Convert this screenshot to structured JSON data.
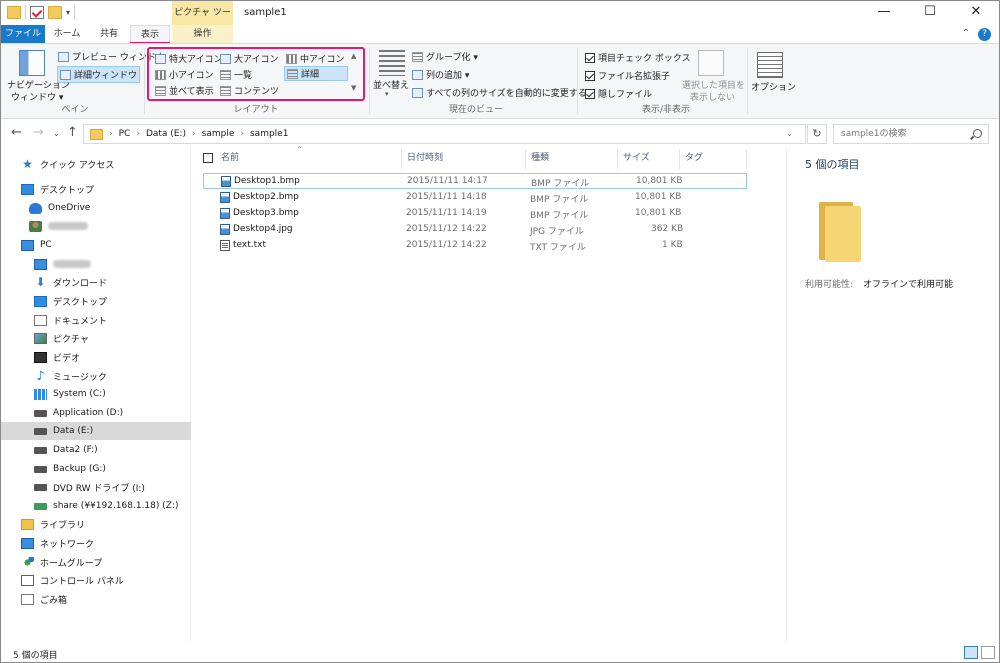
{
  "window": {
    "title": "sample1",
    "context_tab_header": "ピクチャ ツール",
    "minimize": "—",
    "maximize": "☐",
    "close": "✕"
  },
  "tabs": {
    "file": "ファイル",
    "home": "ホーム",
    "share": "共有",
    "view": "表示",
    "manage": "操作"
  },
  "ribbon": {
    "pane": {
      "nav_pane": "ナビゲーション",
      "nav_pane2": "ウィンドウ ▾",
      "preview": "プレビュー ウィンドウ",
      "details": "詳細ウィンドウ",
      "label": "ペイン"
    },
    "layout": {
      "extra_large": "特大アイコン",
      "large": "大アイコン",
      "medium": "中アイコン",
      "small": "小アイコン",
      "list": "一覧",
      "details": "詳細",
      "tiles": "並べて表示",
      "content": "コンテンツ",
      "label": "レイアウト"
    },
    "current_view": {
      "sort": "並べ替え",
      "group": "グループ化 ▾",
      "add_column": "列の追加 ▾",
      "fit_columns": "すべての列のサイズを自動的に変更する",
      "label": "現在のビュー"
    },
    "show_hide": {
      "item_checkboxes": "項目チェック ボックス",
      "extensions": "ファイル名拡張子",
      "hidden": "隠しファイル",
      "hide_selected": "選択した項目を",
      "hide_selected2": "表示しない",
      "label": "表示/非表示"
    },
    "options": "オプション"
  },
  "address": {
    "crumbs": [
      "PC",
      "Data (E:)",
      "sample",
      "sample1"
    ],
    "search_placeholder": "sample1の検索"
  },
  "nav": {
    "quick_access": "クイック アクセス",
    "desktop": "デスクトップ",
    "onedrive": "OneDrive",
    "pc": "PC",
    "downloads": "ダウンロード",
    "desktop2": "デスクトップ",
    "documents": "ドキュメント",
    "pictures": "ピクチャ",
    "videos": "ビデオ",
    "music": "ミュージック",
    "system": "System (C:)",
    "application": "Application (D:)",
    "data": "Data (E:)",
    "data2": "Data2 (F:)",
    "backup": "Backup (G:)",
    "dvd": "DVD RW ドライブ (I:)",
    "share": "share (¥¥192.168.1.18) (Z:)",
    "libraries": "ライブラリ",
    "network": "ネットワーク",
    "homegroup": "ホームグループ",
    "control_panel": "コントロール パネル",
    "recycle": "ごみ箱"
  },
  "columns": {
    "name": "名前",
    "date": "日付時刻",
    "type": "種類",
    "size": "サイズ",
    "tags": "タグ"
  },
  "files": [
    {
      "name": "Desktop1.bmp",
      "date": "2015/11/11 14:17",
      "type": "BMP ファイル",
      "size": "10,801 KB"
    },
    {
      "name": "Desktop2.bmp",
      "date": "2015/11/11 14:18",
      "type": "BMP ファイル",
      "size": "10,801 KB"
    },
    {
      "name": "Desktop3.bmp",
      "date": "2015/11/11 14:19",
      "type": "BMP ファイル",
      "size": "10,801 KB"
    },
    {
      "name": "Desktop4.jpg",
      "date": "2015/11/12 14:22",
      "type": "JPG ファイル",
      "size": "362 KB"
    },
    {
      "name": "text.txt",
      "date": "2015/11/12 14:22",
      "type": "TXT ファイル",
      "size": "1 KB"
    }
  ],
  "details_pane": {
    "count": "5 個の項目",
    "availability_label": "利用可能性:",
    "availability_value": "オフラインで利用可能"
  },
  "status": {
    "count": "5 個の項目"
  }
}
